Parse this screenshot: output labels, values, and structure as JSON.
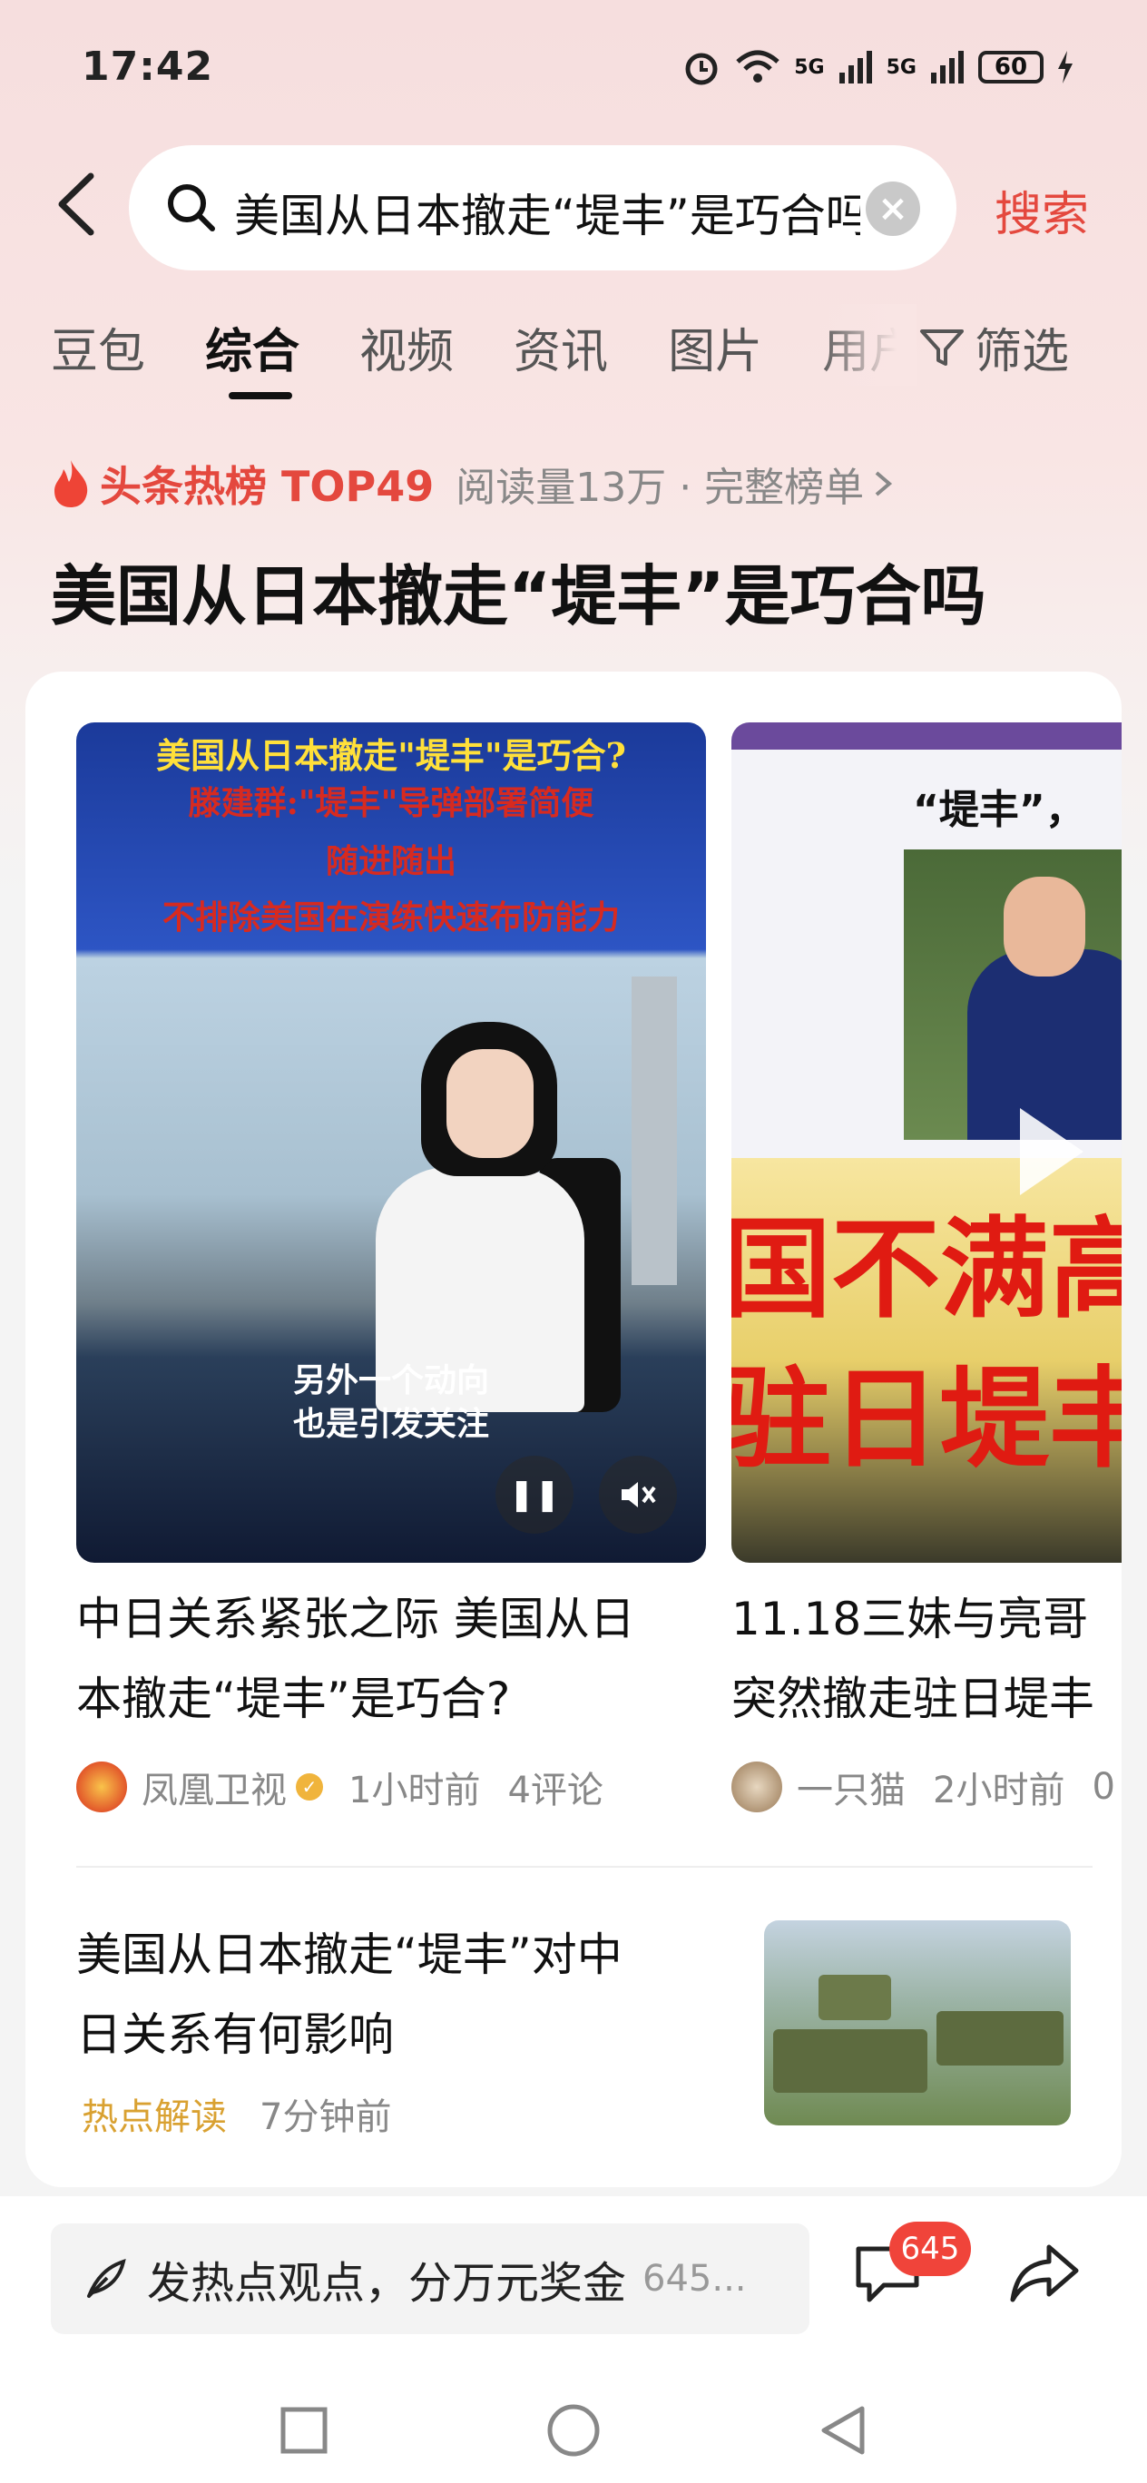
{
  "status_bar": {
    "time": "17:42",
    "battery": "60",
    "network_left": "5G",
    "network_right": "5G"
  },
  "search": {
    "query": "美国从日本撤走“堤丰”是巧合吗",
    "button_label": "搜索"
  },
  "tabs": [
    {
      "label": "豆包"
    },
    {
      "label": "综合"
    },
    {
      "label": "视频"
    },
    {
      "label": "资讯"
    },
    {
      "label": "图片"
    },
    {
      "label": "用户"
    }
  ],
  "filter_label": "筛选",
  "hot": {
    "label": "头条热榜 TOP49",
    "meta": "阅读量13万 · 完整榜单",
    "title": "美国从日本撤走“堤丰”是巧合吗"
  },
  "video1": {
    "overlay_line1": "美国从日本撤走\"堤丰\"是巧合?",
    "overlay_line2": "滕建群:\"堤丰\"导弹部署简便",
    "overlay_line3": "随进随出",
    "overlay_line4": "不排除美国在演练快速布防能力",
    "subtitle_line1": "另外一个动向",
    "subtitle_line2": "也是引发关注",
    "title_line1": "中日关系紧张之际 美国从日",
    "title_line2": "本撤走“堤丰”是巧合?",
    "source": "凤凰卫视",
    "time": "1小时前",
    "comments": "4评论"
  },
  "video2": {
    "overlay_top": "“堤丰”，",
    "overlay_big1": "国不满高",
    "overlay_big2": "驻日堤丰",
    "title_line1": "11.18三妹与亮哥",
    "title_line2": "突然撤走驻日堤丰",
    "source": "一只猫",
    "time": "2小时前",
    "comments": "0"
  },
  "article": {
    "title_line1": "美国从日本撤走“堤丰”对中",
    "title_line2": "日关系有何影响",
    "tag": "热点解读",
    "time": "7分钟前"
  },
  "bottom_bar": {
    "comment_prompt": "发热点观点，分万元奖金",
    "comment_count_text": "645...",
    "badge_count": "645"
  },
  "colors": {
    "accent": "#e4483e",
    "tag": "#d9a131"
  }
}
